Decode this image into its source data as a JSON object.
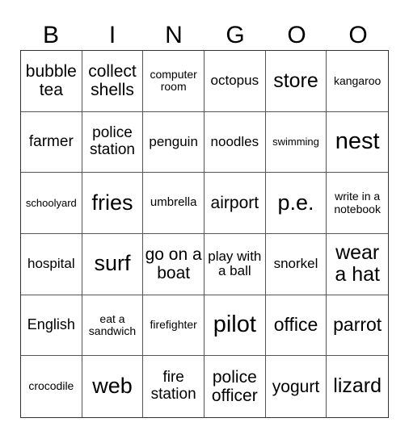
{
  "header": [
    "B",
    "I",
    "N",
    "G",
    "O",
    "O"
  ],
  "cells": [
    "bubble tea",
    "collect shells",
    "computer room",
    "octopus",
    "store",
    "kangaroo",
    "farmer",
    "police station",
    "penguin",
    "noodles",
    "swimming",
    "nest",
    "schoolyard",
    "fries",
    "umbrella",
    "airport",
    "p.e.",
    "write in a notebook",
    "hospital",
    "surf",
    "go on a boat",
    "play with a ball",
    "snorkel",
    "wear a hat",
    "English",
    "eat a sandwich",
    "firefighter",
    "pilot",
    "office",
    "parrot",
    "crocodile",
    "web",
    "fire station",
    "police officer",
    "yogurt",
    "lizard"
  ]
}
